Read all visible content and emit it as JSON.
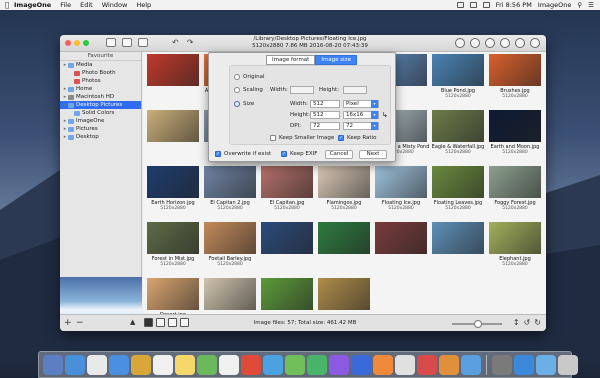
{
  "menubar": {
    "app": "ImageOne",
    "items": [
      "File",
      "Edit",
      "Window",
      "Help"
    ],
    "clock": "Fri 8:56 PM",
    "right_app": "ImageOne"
  },
  "window": {
    "path": "/Library/Desktop Pictures/Floating Ice.jpg",
    "info": "5120x2880  7.86 MB  2016-08-20 07:43:39"
  },
  "sidebar": {
    "header": "Favourite",
    "items": [
      {
        "label": "Media",
        "level": 0,
        "type": "folder"
      },
      {
        "label": "Photo Booth",
        "level": 1,
        "type": "red"
      },
      {
        "label": "Photos",
        "level": 1,
        "type": "red"
      },
      {
        "label": "Home",
        "level": 0,
        "type": "folder"
      },
      {
        "label": "Macintosh HD",
        "level": 0,
        "type": "gray"
      },
      {
        "label": "Desktop Pictures",
        "level": 0,
        "type": "folder",
        "selected": true
      },
      {
        "label": "Solid Colors",
        "level": 1,
        "type": "folder"
      },
      {
        "label": "ImageOne",
        "level": 0,
        "type": "folder"
      },
      {
        "label": "Pictures",
        "level": 0,
        "type": "folder"
      },
      {
        "label": "Desktop",
        "level": 0,
        "type": "folder"
      }
    ]
  },
  "grid": [
    {
      "name": "",
      "size": "",
      "color": "#c0392b"
    },
    {
      "name": "Abstract Shapes.jpg",
      "size": "5120x2880",
      "color": "#e8743a"
    },
    {
      "name": "",
      "size": "",
      "color": "#9bb8d3"
    },
    {
      "name": "",
      "size": "",
      "color": "#7f9ec4"
    },
    {
      "name": "",
      "size": "",
      "color": "#5c86b8"
    },
    {
      "name": "Blue Pond.jpg",
      "size": "5120x2880",
      "color": "#4a83b5"
    },
    {
      "name": "Brushes.jpg",
      "size": "5120x2880",
      "color": "#d95f2b"
    },
    {
      "name": "",
      "size": "",
      "color": "#c9b07a"
    },
    {
      "name": "",
      "size": "",
      "color": "#8d9fb3"
    },
    {
      "name": "",
      "size": "",
      "color": "#b48a9b"
    },
    {
      "name": "Death Valley.jpg",
      "size": "5120x2880",
      "color": "#b5a08a"
    },
    {
      "name": "Ducks on a Misty Pond.jpg",
      "size": "5120x2880",
      "color": "#a9b9c0"
    },
    {
      "name": "Eagle & Waterfall.jpg",
      "size": "5120x2880",
      "color": "#6c7c49"
    },
    {
      "name": "Earth and Moon.jpg",
      "size": "5120x2880",
      "color": "#0e1a33"
    },
    {
      "name": "Earth Horizon.jpg",
      "size": "5120x2880",
      "color": "#1d3c6e"
    },
    {
      "name": "El Capitan 2.jpg",
      "size": "5120x2880",
      "color": "#6f84a4"
    },
    {
      "name": "El Capitan.jpg",
      "size": "5120x2880",
      "color": "#b5706a"
    },
    {
      "name": "Flamingos.jpg",
      "size": "5120x2880",
      "color": "#d9c9b6"
    },
    {
      "name": "Floating Ice.jpg",
      "size": "5120x2880",
      "color": "#9fc3dd"
    },
    {
      "name": "Floating Leaves.jpg",
      "size": "5120x2880",
      "color": "#6a8a3e"
    },
    {
      "name": "Foggy Forest.jpg",
      "size": "5120x2880",
      "color": "#8ca08e"
    },
    {
      "name": "Forest in Mist.jpg",
      "size": "5120x2880",
      "color": "#5e6b45"
    },
    {
      "name": "Foxtail Barley.jpg",
      "size": "5120x2880",
      "color": "#c38a5a"
    },
    {
      "name": "",
      "size": "",
      "color": "#2b4a7a"
    },
    {
      "name": "",
      "size": "",
      "color": "#2d7a3e"
    },
    {
      "name": "",
      "size": "",
      "color": "#7a3b3b"
    },
    {
      "name": "",
      "size": "",
      "color": "#5d8fb8"
    },
    {
      "name": "Elephant.jpg",
      "size": "5120x2880",
      "color": "#a3b05c"
    },
    {
      "name": "Desert.jpg",
      "size": "5120x2880",
      "color": "#d9a46f"
    },
    {
      "name": "",
      "size": "",
      "color": "#cfc3ad"
    },
    {
      "name": "",
      "size": "",
      "color": "#5c9a3a"
    },
    {
      "name": "",
      "size": "",
      "color": "#b08d4a"
    }
  ],
  "status": {
    "files_text": "Image files: 57;  Total size: 461.42 MB"
  },
  "dialog": {
    "tab_format": "Image format",
    "tab_size": "Image size",
    "opt_original": "Original",
    "opt_scaling": "Scaling",
    "opt_size": "Size",
    "lbl_width": "Width:",
    "lbl_height": "Height:",
    "lbl_dpi": "DPI:",
    "scale_width": "",
    "scale_height": "",
    "width": "512",
    "height": "512",
    "dpi": "72",
    "dpi2": "72",
    "unit": "Pixel",
    "preset": "16x16",
    "keep_smaller": "Keep Smaller Image",
    "keep_ratio": "Keep Ratio",
    "overwrite": "Overwrite if exist",
    "keep_exif": "Keep EXIF",
    "cancel": "Cancel",
    "next": "Next"
  },
  "dock_colors": [
    "#5b7fc2",
    "#4a8fd9",
    "#e9e9e9",
    "#4a8fe0",
    "#d9a63a",
    "#f0f0f0",
    "#f6d76a",
    "#6cb85c",
    "#f0f0f0",
    "#e04a3a",
    "#4aa3e0",
    "#6fbf5a",
    "#4ab36a",
    "#8a5ae0",
    "#3a6ad9",
    "#f08a3a",
    "#e0e0e0",
    "#d94a4a",
    "#e0903a",
    "#5a9ee0",
    "#7a7a7a",
    "#3a8ad9",
    "#6ab0e6",
    "#c9c9c9"
  ]
}
